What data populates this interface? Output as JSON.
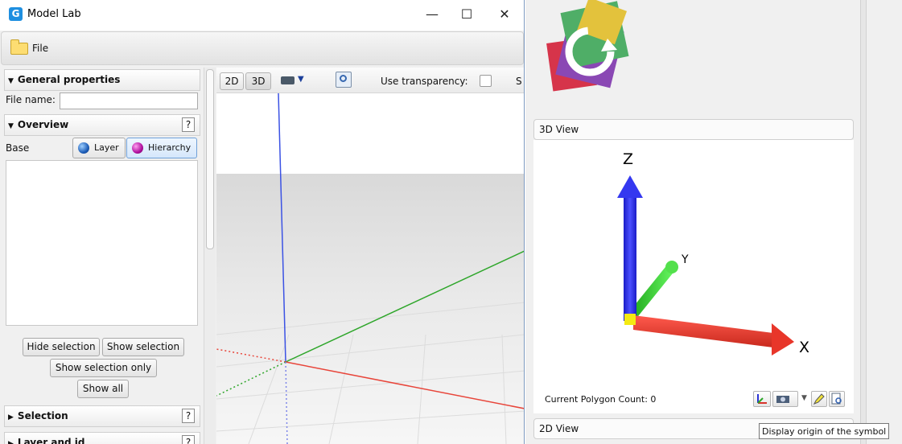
{
  "window": {
    "title": "Model Lab",
    "minimize_glyph": "—",
    "maximize_glyph": "☐",
    "close_glyph": "✕"
  },
  "menu": {
    "file": "File"
  },
  "panel": {
    "general_properties": "General properties",
    "file_name_label": "File name:",
    "file_name_value": "",
    "overview": "Overview",
    "overview_help": "?",
    "base_label": "Base",
    "layer_button": "Layer",
    "hierarchy_button": "Hierarchy",
    "hide_selection": "Hide selection",
    "show_selection": "Show selection",
    "show_selection_only": "Show selection only",
    "show_all": "Show all",
    "selection": "Selection",
    "selection_help": "?",
    "layer_and_id": "Layer and id",
    "layer_and_id_help": "?"
  },
  "viewport": {
    "btn_2d": "2D",
    "btn_3d": "3D",
    "use_transparency": "Use transparency:",
    "transparency_checked": false,
    "truncated_label": "S"
  },
  "right": {
    "view3d_header": "3D View",
    "view2d_header": "2D View",
    "axis_x": "X",
    "axis_y": "Y",
    "axis_z": "Z",
    "polygon_count": "Current Polygon Count: 0",
    "tooltip": "Display origin of the symbol"
  },
  "colors": {
    "x_axis": "#e43a2f",
    "y_axis": "#2fcc29",
    "z_axis": "#2b33e6",
    "selected_button": "#d5e7fb"
  }
}
